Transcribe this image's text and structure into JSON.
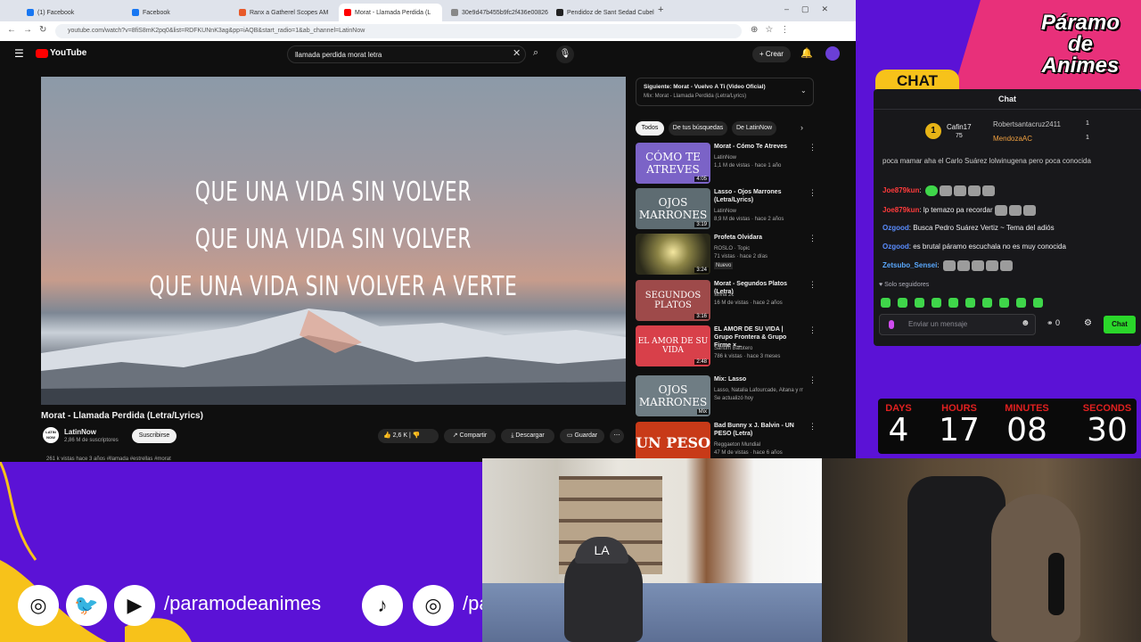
{
  "browser": {
    "tabs": [
      {
        "label": "(1) Facebook",
        "color": "#1877f2"
      },
      {
        "label": "Facebook",
        "color": "#1877f2"
      },
      {
        "label": "Ranx a Gatherel Scopes AM",
        "color": "#e85a2a"
      },
      {
        "label": "Morat - Llamada Perdida (L",
        "color": "#ff0000"
      },
      {
        "label": "30e9d47b455b9fc2f436e00826",
        "color": "#888888"
      },
      {
        "label": "Pendidoz de Sant Sedad Cubel",
        "color": "#222222"
      }
    ],
    "url": "youtube.com/watch?v=8fiS8mK2pq0&list=RDFKUNnK3ag&pp=iAQB&start_radio=1&ab_channel=LatinNow"
  },
  "youtube": {
    "search_value": "llamada perdida morat letra",
    "create_label": "Crear",
    "lyrics": [
      "QUE UNA VIDA SIN VOLVER",
      "QUE UNA VIDA SIN VOLVER",
      "QUE UNA VIDA SIN VOLVER A VERTE"
    ],
    "video_title": "Morat - Llamada Perdida (Letra/Lyrics)",
    "channel_name": "LatinNow",
    "channel_avatar_text": "LATIN NOW",
    "subscribers": "2,86 M de suscriptores",
    "subscribe_label": "Suscribirse",
    "likes": "2,6 K",
    "share_label": "Compartir",
    "download_label": "Descargar",
    "save_label": "Guardar",
    "views_line": "261 k vistas  hace 3 años  #llamada #estrellas #morat",
    "next_label": "Siguiente: Morat - Vuelvo A Ti (Video Oficial)",
    "next_sub": "Mix: Morat - Llamada Perdida (Letra/Lyrics)",
    "chips": [
      "Todos",
      "De tus búsquedas",
      "De LatinNow"
    ],
    "recommendations": [
      {
        "title": "Morat - Cómo Te Atreves",
        "channel": "LatinNow",
        "meta": "1,1 M de vistas · hace 1 año",
        "thumb_text": "CÓMO TE ATREVES",
        "duration": "4:05",
        "color": "#7b63c7"
      },
      {
        "title": "Lasso - Ojos Marrones (Letra/Lyrics)",
        "channel": "LatinNow",
        "meta": "8,9 M de vistas · hace 2 años",
        "thumb_text": "OJOS MARRONES",
        "duration": "3:19",
        "color": "#5e6c72"
      },
      {
        "title": "Profeta Olvidara",
        "channel": "ROSLO · Topic",
        "meta": "71 vistas · hace 2 días",
        "badge": "Nuevo",
        "thumb_text": "",
        "duration": "3:24",
        "color": "#4b4a30"
      },
      {
        "title": "Morat - Segundos Platos (Letra)",
        "channel": "Silvia 2c",
        "meta": "16 M de vistas · hace 2 años",
        "thumb_text": "SEGUNDOS PLATOS",
        "duration": "3:16",
        "color": "#9e4a4a"
      },
      {
        "title": "EL AMOR DE SU VIDA | Grupo Frontera & Grupo Firme ×...",
        "channel": "Sanum Batotero",
        "meta": "786 k vistas · hace 3 meses",
        "thumb_text": "EL AMOR DE SU VIDA",
        "duration": "2:48",
        "color": "#d8404a"
      },
      {
        "title": "Mix: Lasso",
        "channel": "Lasso, Natalia Lafourcade, Aitana y más",
        "meta": "Se actualizó hoy",
        "thumb_text": "OJOS MARRONES",
        "duration": "Mix",
        "color": "#6f7d84"
      },
      {
        "title": "Bad Bunny x J. Balvin - UN PESO (Letra)",
        "channel": "Reggaeton Mundial",
        "meta": "47 M de vistas · hace 6 años",
        "thumb_text": "UN PESO",
        "duration": "",
        "color": "#c83a18"
      }
    ]
  },
  "overlay": {
    "logo_lines": [
      "Páramo",
      "de",
      "Animes"
    ],
    "chat_tab_label": "CHAT",
    "handle": "/paramodeanimes",
    "handle_cut": "/pa",
    "colors": {
      "purple": "#5b12d6",
      "pink": "#e8307a",
      "yellow": "#f7c21a",
      "red": "#e02020"
    }
  },
  "chat": {
    "title": "Chat",
    "leaderboard": [
      {
        "rank": "1",
        "name": "Cafin17",
        "points": "75"
      },
      {
        "rank": "",
        "name": "Robertsantacruz2411",
        "points": "1"
      },
      {
        "rank": "",
        "name": "MendozaAC",
        "points": "1"
      }
    ],
    "messages": [
      {
        "user": "Ozgood",
        "text": "Busca Pedro Suárez Vertiz ~ Tema del adiós",
        "user_color": "#5a8dff"
      },
      {
        "user": "Ozgood",
        "text": "es brutal páramo escuchala no es muy conocida",
        "user_color": "#5a8dff"
      },
      {
        "user": "Joe879kun",
        "text": "",
        "user_color": "#ff3b3b"
      },
      {
        "user": "Joe879kun",
        "text": "lp temazo pa recordar",
        "user_color": "#ff3b3b"
      },
      {
        "user": "Zetsubo_Sensei",
        "text": "",
        "user_color": "#5aa9ff"
      }
    ],
    "partial_line": "poca mamar aha el Carlo Suárez lolwinugena pero poca conocida",
    "followers_only": "Solo seguidores",
    "input_placeholder": "Enviar un mensaje",
    "points": "0",
    "send_label": "Chat"
  },
  "countdown": {
    "labels": [
      "DAYS",
      "HOURS",
      "MINUTES",
      "SECONDS"
    ],
    "values": [
      "4",
      "17",
      "08",
      "30"
    ]
  }
}
